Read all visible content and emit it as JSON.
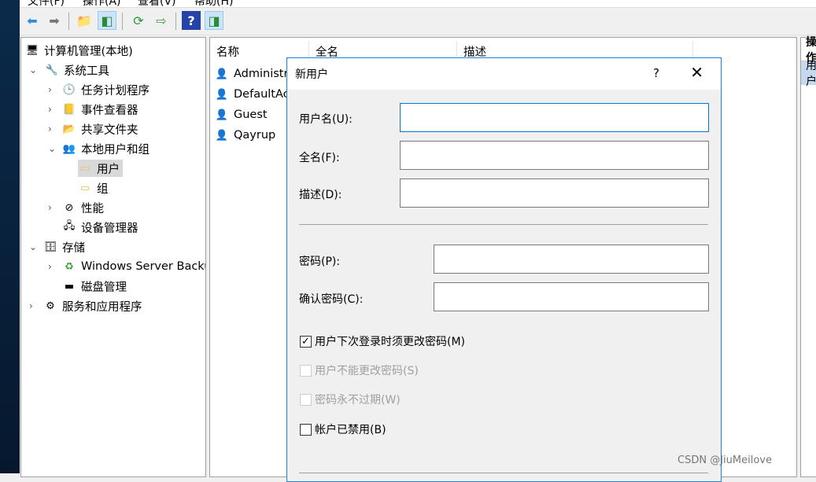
{
  "menu": [
    "文件(F)",
    "操作(A)",
    "查看(V)",
    "帮助(H)"
  ],
  "toolbar": [
    {
      "icon": "back-arrow-icon"
    },
    {
      "icon": "forward-arrow-icon"
    },
    {
      "icon": "up-folder-icon"
    },
    {
      "icon": "show-hide-console-tree-icon"
    },
    {
      "icon": "refresh-icon"
    },
    {
      "icon": "export-list-icon"
    },
    {
      "icon": "help-icon"
    },
    {
      "icon": "show-hide-action-pane-icon"
    }
  ],
  "tree": [
    {
      "label": "计算机管理(本地)",
      "icon": "computer-management-icon"
    },
    {
      "label": "系统工具",
      "icon": "tools-icon",
      "expanded": true
    },
    {
      "label": "任务计划程序",
      "icon": "clock-icon"
    },
    {
      "label": "事件查看器",
      "icon": "event-viewer-icon"
    },
    {
      "label": "共享文件夹",
      "icon": "shared-folder-icon"
    },
    {
      "label": "本地用户和组",
      "icon": "users-group-icon",
      "expanded": true
    },
    {
      "label": "用户",
      "icon": "folder-icon",
      "selected": true
    },
    {
      "label": "组",
      "icon": "folder-icon"
    },
    {
      "label": "性能",
      "icon": "performance-icon"
    },
    {
      "label": "设备管理器",
      "icon": "device-manager-icon"
    },
    {
      "label": "存储",
      "icon": "storage-icon",
      "expanded": true
    },
    {
      "label": "Windows Server Backup",
      "icon": "backup-icon"
    },
    {
      "label": "磁盘管理",
      "icon": "disk-icon"
    },
    {
      "label": "服务和应用程序",
      "icon": "services-icon"
    }
  ],
  "list": {
    "columns": [
      "名称",
      "全名",
      "描述"
    ],
    "rows": [
      "Administrator",
      "DefaultAccount",
      "Guest",
      "Qayrup"
    ]
  },
  "action_pane": {
    "header": "操作",
    "selected": "用户"
  },
  "dialog": {
    "title": "新用户",
    "help": "?",
    "close": "✕",
    "username_label": "用户名(U):",
    "username_value": "",
    "fullname_label": "全名(F):",
    "fullname_value": "",
    "desc_label": "描述(D):",
    "desc_value": "",
    "password_label": "密码(P):",
    "password_value": "",
    "confirm_label": "确认密码(C):",
    "confirm_value": "",
    "checkboxes": [
      {
        "label": "用户下次登录时须更改密码(M)",
        "checked": true,
        "enabled": true
      },
      {
        "label": "用户不能更改密码(S)",
        "checked": false,
        "enabled": false
      },
      {
        "label": "密码永不过期(W)",
        "checked": false,
        "enabled": false
      },
      {
        "label": "帐户已禁用(B)",
        "checked": false,
        "enabled": true
      }
    ]
  },
  "watermark": "CSDN @JiuMeilove",
  "colors": {
    "accent": "#0078d7",
    "selection": "#cce4f7"
  }
}
